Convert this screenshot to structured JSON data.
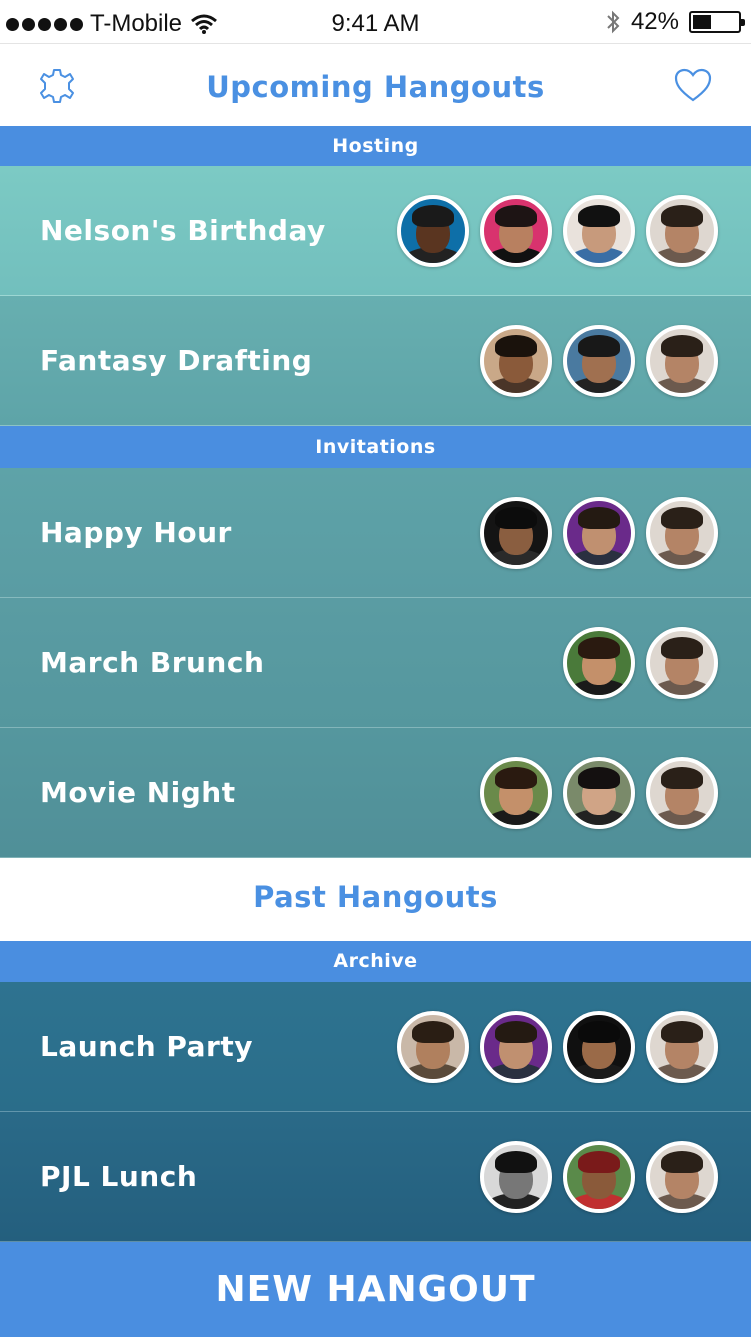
{
  "status_bar": {
    "carrier": "T-Mobile",
    "time": "9:41 AM",
    "battery": "42%",
    "battery_level": 0.42,
    "signal_icon": "signal-dots-icon",
    "wifi_icon": "wifi-icon",
    "bluetooth_icon": "bluetooth-icon"
  },
  "nav": {
    "title": "Upcoming Hangouts",
    "left_icon": "settings-gear-icon",
    "right_icon": "heart-icon"
  },
  "sections": {
    "hosting": "Hosting",
    "invitations": "Invitations",
    "past_title": "Past Hangouts",
    "archive": "Archive"
  },
  "hosting_rows": [
    {
      "title": "Nelson's Birthday",
      "avatars": 4
    },
    {
      "title": "Fantasy Drafting",
      "avatars": 3
    }
  ],
  "invitation_rows": [
    {
      "title": "Happy Hour",
      "avatars": 3
    },
    {
      "title": "March Brunch",
      "avatars": 2
    },
    {
      "title": "Movie Night",
      "avatars": 3
    }
  ],
  "archive_rows": [
    {
      "title": "Launch Party",
      "avatars": 4
    },
    {
      "title": "PJL Lunch",
      "avatars": 3
    }
  ],
  "bottom_button": "NEW HANGOUT",
  "colors": {
    "accent": "#4a90e2",
    "section_header": "#4a8ee0",
    "row_hosting_top": "#78c3c0",
    "row_invitation": "#5a9ca3",
    "row_archive": "#2a6d8a"
  }
}
